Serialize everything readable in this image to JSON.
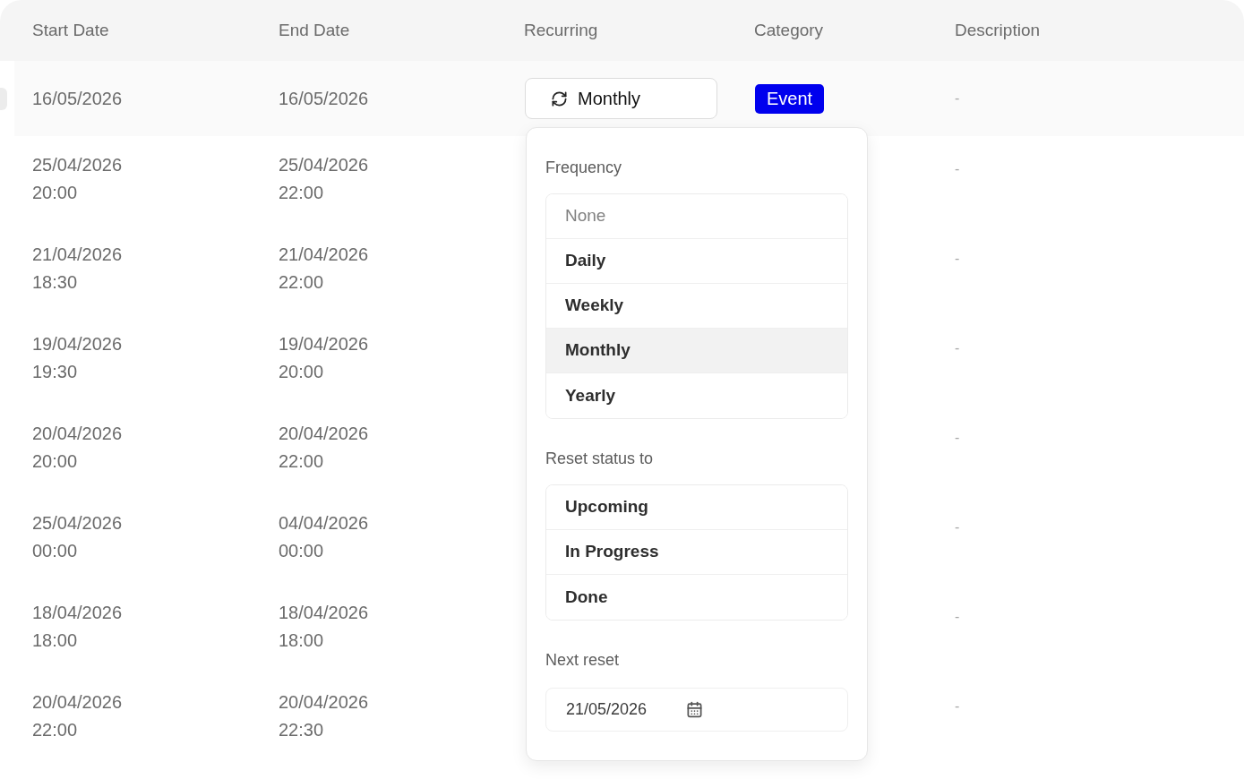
{
  "table": {
    "columns": [
      "Start Date",
      "End Date",
      "Recurring",
      "Category",
      "Description"
    ],
    "rows": [
      {
        "selected": true,
        "start": {
          "date": "16/05/2026"
        },
        "end": {
          "date": "16/05/2026"
        },
        "recurring": "Monthly",
        "category": "Event",
        "description": "-"
      },
      {
        "selected": false,
        "start": {
          "date": "25/04/2026",
          "time": "20:00"
        },
        "end": {
          "date": "25/04/2026",
          "time": "22:00"
        },
        "description": "-"
      },
      {
        "selected": false,
        "start": {
          "date": "21/04/2026",
          "time": "18:30"
        },
        "end": {
          "date": "21/04/2026",
          "time": "22:00"
        },
        "description": "-"
      },
      {
        "selected": false,
        "start": {
          "date": "19/04/2026",
          "time": "19:30"
        },
        "end": {
          "date": "19/04/2026",
          "time": "20:00"
        },
        "description": "-"
      },
      {
        "selected": false,
        "start": {
          "date": "20/04/2026",
          "time": "20:00"
        },
        "end": {
          "date": "20/04/2026",
          "time": "22:00"
        },
        "description": "-"
      },
      {
        "selected": false,
        "start": {
          "date": "25/04/2026",
          "time": "00:00"
        },
        "end": {
          "date": "04/04/2026",
          "time": "00:00"
        },
        "description": "-"
      },
      {
        "selected": false,
        "start": {
          "date": "18/04/2026",
          "time": "18:00"
        },
        "end": {
          "date": "18/04/2026",
          "time": "18:00"
        },
        "description": "-"
      },
      {
        "selected": false,
        "start": {
          "date": "20/04/2026",
          "time": "22:00"
        },
        "end": {
          "date": "20/04/2026",
          "time": "22:30"
        },
        "description": "-"
      }
    ]
  },
  "recurrence_popover": {
    "frequency": {
      "label": "Frequency",
      "options": [
        {
          "label": "None",
          "kind": "empty",
          "selected": false
        },
        {
          "label": "Daily",
          "kind": "value",
          "selected": false
        },
        {
          "label": "Weekly",
          "kind": "value",
          "selected": false
        },
        {
          "label": "Monthly",
          "kind": "value",
          "selected": true
        },
        {
          "label": "Yearly",
          "kind": "value",
          "selected": false
        }
      ]
    },
    "reset_status": {
      "label": "Reset status to",
      "options": [
        {
          "label": "Upcoming",
          "kind": "value",
          "selected": false
        },
        {
          "label": "In Progress",
          "kind": "value",
          "selected": false
        },
        {
          "label": "Done",
          "kind": "value",
          "selected": false
        }
      ]
    },
    "next_reset": {
      "label": "Next reset",
      "value": "21/05/2026"
    }
  }
}
